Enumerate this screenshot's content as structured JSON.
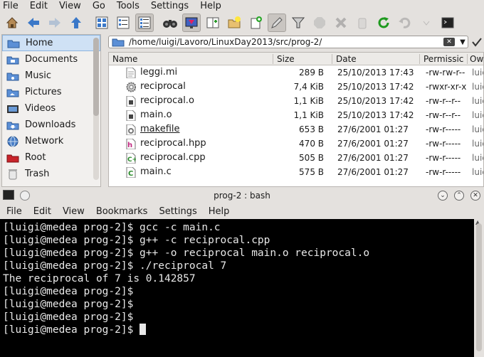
{
  "file_manager": {
    "menu": [
      "File",
      "Edit",
      "View",
      "Go",
      "Tools",
      "Settings",
      "Help"
    ],
    "places": [
      {
        "label": "Home",
        "icon": "home-folder-icon",
        "active": true
      },
      {
        "label": "Documents",
        "icon": "documents-folder-icon"
      },
      {
        "label": "Music",
        "icon": "music-folder-icon"
      },
      {
        "label": "Pictures",
        "icon": "pictures-folder-icon"
      },
      {
        "label": "Videos",
        "icon": "videos-folder-icon"
      },
      {
        "label": "Downloads",
        "icon": "downloads-folder-icon"
      },
      {
        "label": "Network",
        "icon": "network-icon"
      },
      {
        "label": "Root",
        "icon": "root-folder-icon"
      },
      {
        "label": "Trash",
        "icon": "trash-icon"
      }
    ],
    "location": "/home/luigi/Lavoro/LinuxDay2013/src/prog-2/",
    "columns": {
      "name": "Name",
      "size": "Size",
      "date": "Date",
      "permissions": "Permissic",
      "owner": "Ow"
    },
    "files": [
      {
        "name": "leggi.mi",
        "size": "289 B",
        "date": "25/10/2013 17:43",
        "perm": "-rw-rw-r--",
        "owner": "luic",
        "icon": "text-file-icon"
      },
      {
        "name": "reciprocal",
        "size": "7,4 KiB",
        "date": "25/10/2013 17:42",
        "perm": "-rwxr-xr-x",
        "owner": "luic",
        "icon": "executable-gear-icon"
      },
      {
        "name": "reciprocal.o",
        "size": "1,1 KiB",
        "date": "25/10/2013 17:42",
        "perm": "-rw-r--r--",
        "owner": "luic",
        "icon": "object-file-icon"
      },
      {
        "name": "main.o",
        "size": "1,1 KiB",
        "date": "25/10/2013 17:42",
        "perm": "-rw-r--r--",
        "owner": "luic",
        "icon": "object-file-icon"
      },
      {
        "name": "makefile",
        "size": "653 B",
        "date": "27/6/2001 01:27",
        "perm": "-rw-r-----",
        "owner": "luic",
        "icon": "makefile-icon"
      },
      {
        "name": "reciprocal.hpp",
        "size": "470 B",
        "date": "27/6/2001 01:27",
        "perm": "-rw-r-----",
        "owner": "luic",
        "icon": "header-file-icon"
      },
      {
        "name": "reciprocal.cpp",
        "size": "505 B",
        "date": "27/6/2001 01:27",
        "perm": "-rw-r-----",
        "owner": "luic",
        "icon": "cpp-file-icon"
      },
      {
        "name": "main.c",
        "size": "575 B",
        "date": "27/6/2001 01:27",
        "perm": "-rw-r-----",
        "owner": "luic",
        "icon": "c-file-icon"
      }
    ]
  },
  "terminal": {
    "title": "prog-2 : bash",
    "menu": [
      "File",
      "Edit",
      "View",
      "Bookmarks",
      "Settings",
      "Help"
    ],
    "lines": [
      "[luigi@medea prog-2]$ gcc -c main.c",
      "[luigi@medea prog-2]$ g++ -c reciprocal.cpp",
      "[luigi@medea prog-2]$ g++ -o reciprocal main.o reciprocal.o",
      "[luigi@medea prog-2]$ ./reciprocal 7",
      "The reciprocal of 7 is 0.142857",
      "[luigi@medea prog-2]$",
      "[luigi@medea prog-2]$",
      "[luigi@medea prog-2]$"
    ],
    "prompt": "[luigi@medea prog-2]$ "
  }
}
